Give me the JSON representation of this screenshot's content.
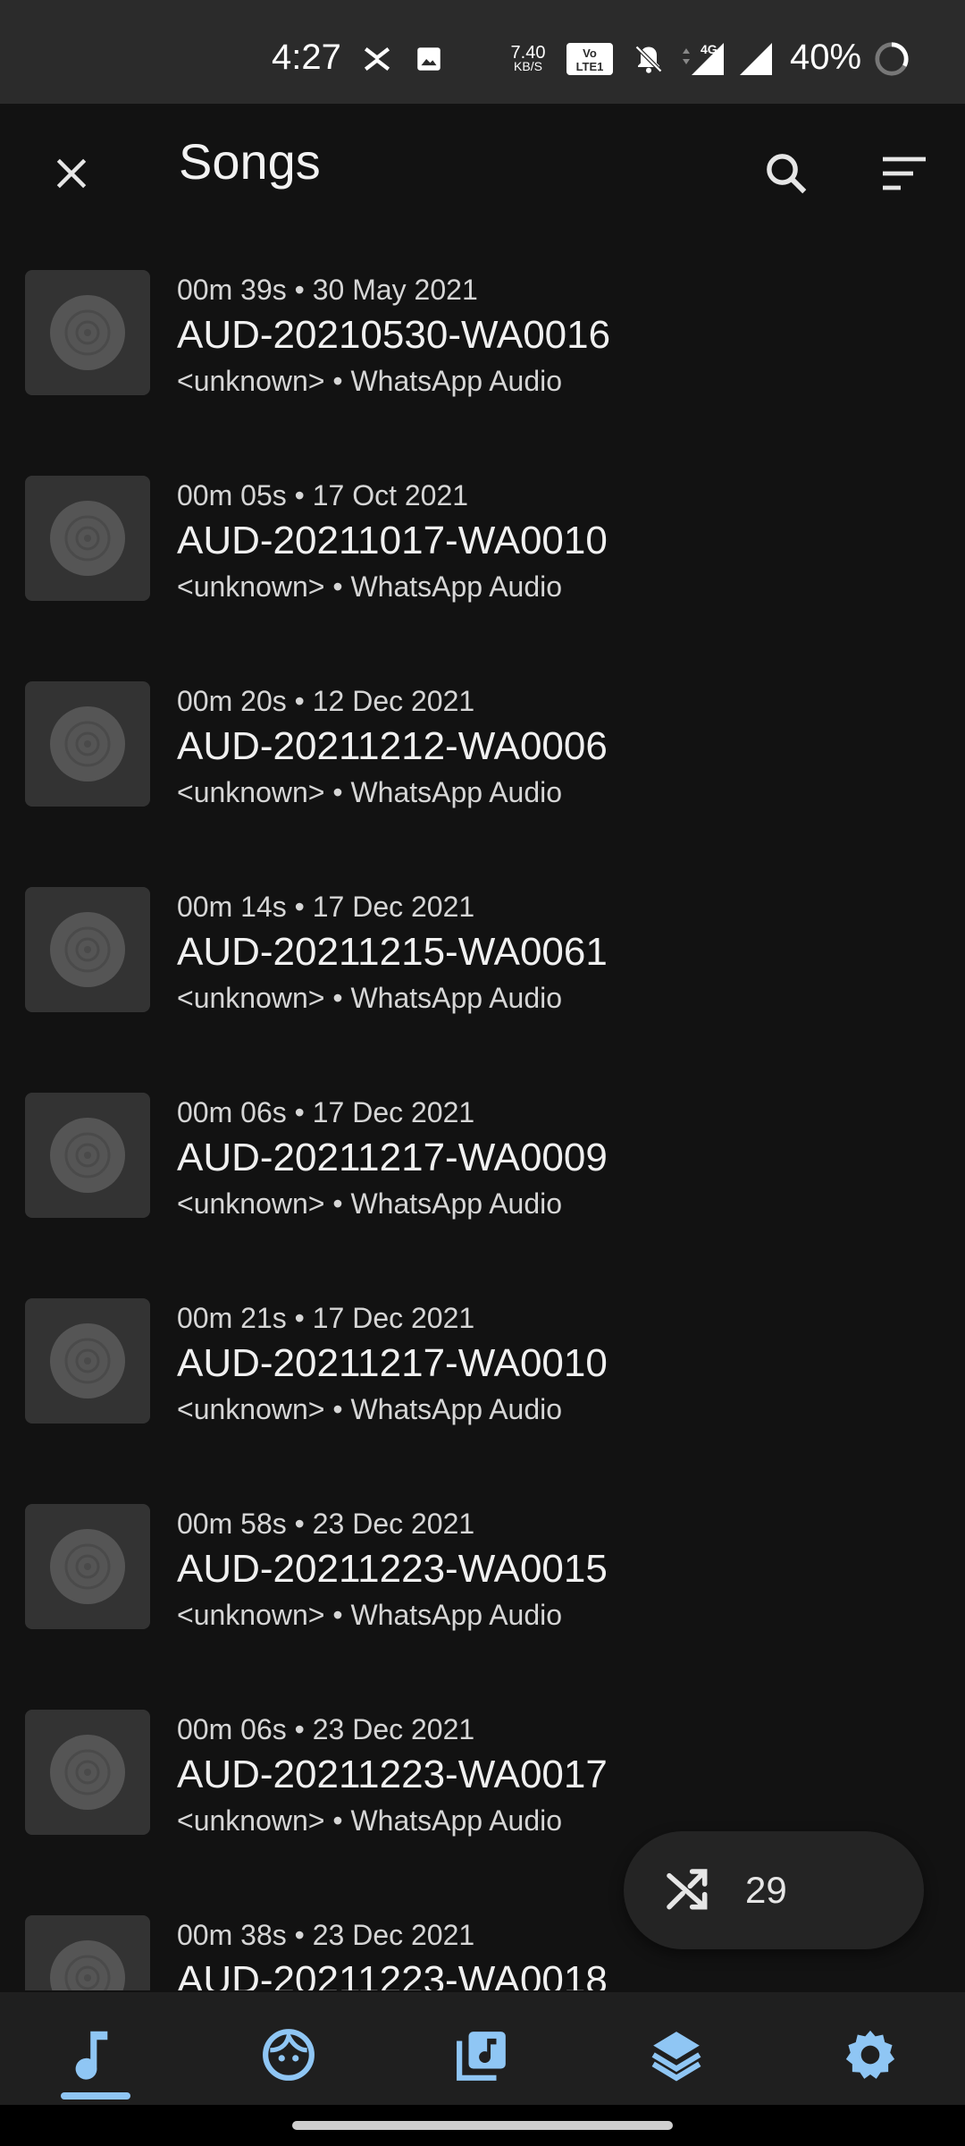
{
  "status_bar": {
    "time": "4:27",
    "speed_value": "7.40",
    "speed_unit": "KB/S",
    "network": "4G",
    "battery": "40%"
  },
  "app_bar": {
    "title": "Songs",
    "close_icon": "close-icon",
    "search_icon": "search-icon",
    "sort_icon": "sort-icon"
  },
  "songs": [
    {
      "meta": "00m 39s • 30 May 2021",
      "title": "AUD-20210530-WA0016",
      "subtitle": "<unknown> • WhatsApp Audio"
    },
    {
      "meta": "00m 05s • 17 Oct 2021",
      "title": "AUD-20211017-WA0010",
      "subtitle": "<unknown> • WhatsApp Audio"
    },
    {
      "meta": "00m 20s • 12 Dec 2021",
      "title": "AUD-20211212-WA0006",
      "subtitle": "<unknown> • WhatsApp Audio"
    },
    {
      "meta": "00m 14s • 17 Dec 2021",
      "title": "AUD-20211215-WA0061",
      "subtitle": "<unknown> • WhatsApp Audio"
    },
    {
      "meta": "00m 06s • 17 Dec 2021",
      "title": "AUD-20211217-WA0009",
      "subtitle": "<unknown> • WhatsApp Audio"
    },
    {
      "meta": "00m 21s • 17 Dec 2021",
      "title": "AUD-20211217-WA0010",
      "subtitle": "<unknown> • WhatsApp Audio"
    },
    {
      "meta": "00m 58s • 23 Dec 2021",
      "title": "AUD-20211223-WA0015",
      "subtitle": "<unknown> • WhatsApp Audio"
    },
    {
      "meta": "00m 06s • 23 Dec 2021",
      "title": "AUD-20211223-WA0017",
      "subtitle": "<unknown> • WhatsApp Audio"
    },
    {
      "meta": "00m 38s • 23 Dec 2021",
      "title": "AUD-20211223-WA0018",
      "subtitle": ""
    }
  ],
  "shuffle_fab": {
    "icon": "shuffle-icon",
    "count": "29"
  },
  "bottom_nav": {
    "items": [
      "music-note-icon",
      "face-icon",
      "library-music-icon",
      "layers-icon",
      "settings-icon"
    ],
    "active_index": 0
  },
  "colors": {
    "background": "#121212",
    "status_bar": "#2b2b2b",
    "thumb": "#333333",
    "accent": "#8fc6f4",
    "nav_bar": "#1f1f1f"
  }
}
